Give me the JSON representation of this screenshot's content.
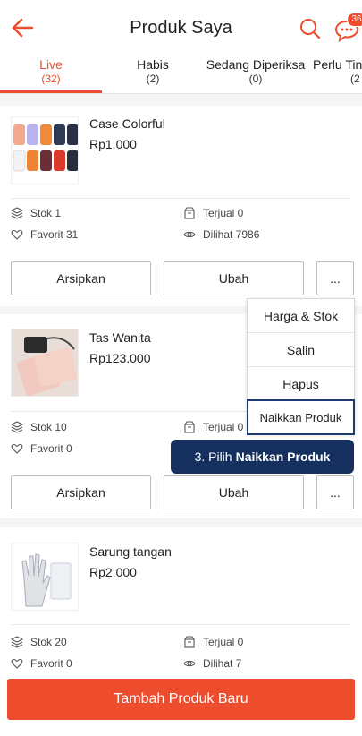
{
  "header": {
    "title": "Produk Saya",
    "chat_badge": "36"
  },
  "tabs": [
    {
      "label": "Live",
      "count": "(32)"
    },
    {
      "label": "Habis",
      "count": "(2)"
    },
    {
      "label": "Sedang Diperiksa",
      "count": "(0)"
    },
    {
      "label": "Perlu Tin",
      "count": "(2"
    }
  ],
  "products": [
    {
      "name": "Case Colorful",
      "price": "Rp1.000",
      "stok": "Stok 1",
      "terjual": "Terjual 0",
      "favorit": "Favorit 31",
      "dilihat": "Dilihat 7986",
      "archive_label": "Arsipkan",
      "edit_label": "Ubah",
      "more_label": "..."
    },
    {
      "name": "Tas Wanita",
      "price": "Rp123.000",
      "stok": "Stok 10",
      "terjual": "Terjual 0",
      "favorit": "Favorit 0",
      "archive_label": "Arsipkan",
      "edit_label": "Ubah",
      "more_label": "..."
    },
    {
      "name": "Sarung tangan",
      "price": "Rp2.000",
      "stok": "Stok 20",
      "terjual": "Terjual 0",
      "favorit": "Favorit 0",
      "dilihat": "Dilihat 7"
    }
  ],
  "menu": {
    "items": [
      "Harga & Stok",
      "Salin",
      "Hapus",
      "Naikkan Produk"
    ]
  },
  "tooltip": {
    "prefix": "3. Pilih",
    "bold": "Naikkan Produk"
  },
  "bottom": {
    "add_label": "Tambah Produk Baru"
  },
  "colors": {
    "accent": "#ee4d2d",
    "tooltip_bg": "#15305e"
  }
}
